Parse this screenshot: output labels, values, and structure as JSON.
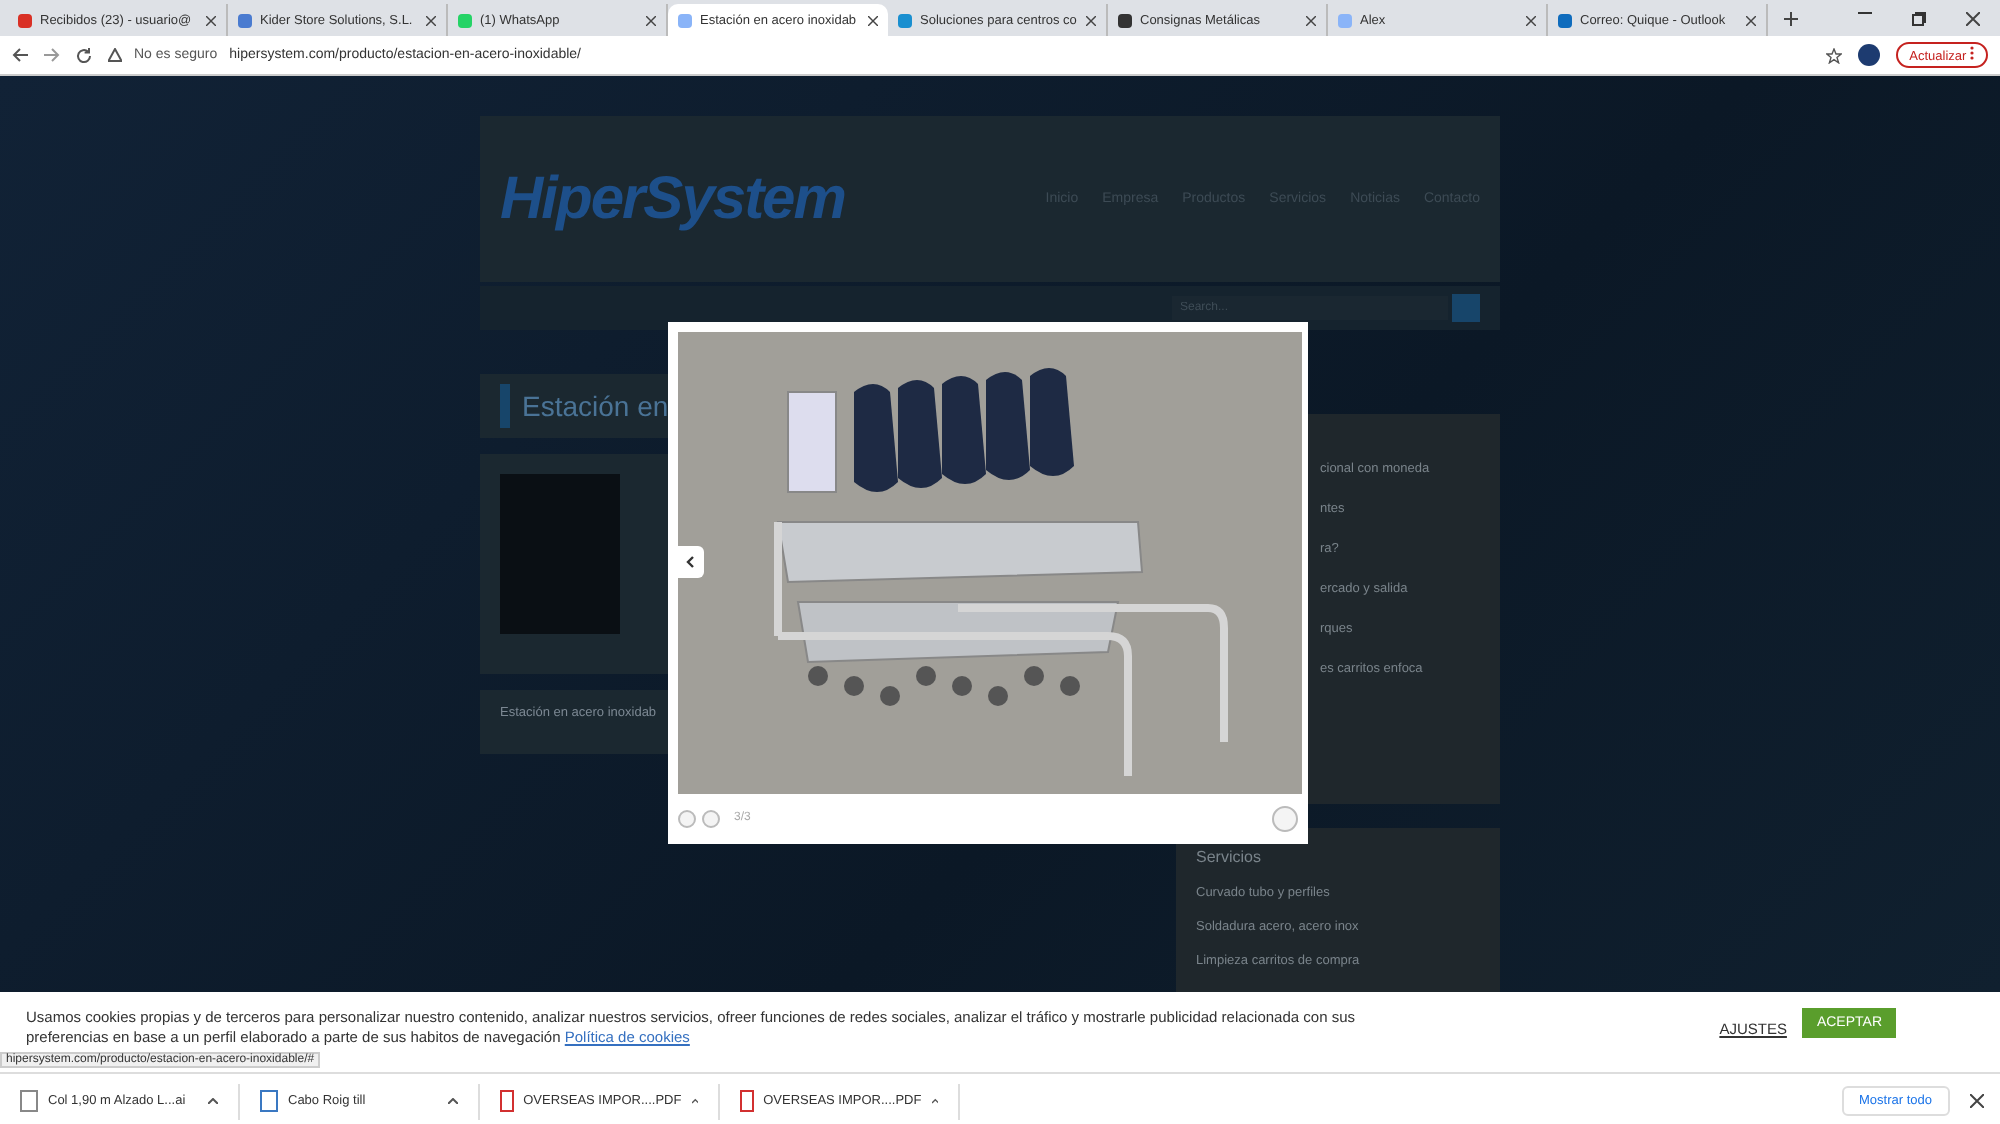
{
  "browser": {
    "tabs": [
      {
        "title": "Recibidos (23) - usuario@",
        "kind": "mail",
        "selected": false
      },
      {
        "title": "Kider Store Solutions, S.L.",
        "kind": "site",
        "selected": false
      },
      {
        "title": "(1) WhatsApp",
        "kind": "chat",
        "selected": false
      },
      {
        "title": "Estación en acero inoxidab",
        "kind": "page",
        "selected": true
      },
      {
        "title": "Soluciones para centros co",
        "kind": "globe",
        "selected": false
      },
      {
        "title": "Consignas Metálicas",
        "kind": "dark",
        "selected": false
      },
      {
        "title": "Alex",
        "kind": "page",
        "selected": false
      },
      {
        "title": "Correo: Quique - Outlook",
        "kind": "outlook",
        "selected": false
      }
    ],
    "security": "No es seguro",
    "url": "hipersystem.com/producto/estacion-en-acero-inoxidable/",
    "update_button": "Actualizar"
  },
  "site": {
    "logo": "HiperSystem",
    "nav": [
      "Inicio",
      "Empresa",
      "Productos",
      "Servicios",
      "Noticias",
      "Contacto"
    ],
    "search": {
      "placeholder": "Search..."
    },
    "page_title": "Estación en",
    "description": "Estación en acero inoxidab",
    "sidebar": [
      "cional con moneda",
      "ntes",
      "ra?",
      "ercado y salida",
      "rques",
      "es carritos enfoca"
    ],
    "services": {
      "title": "Servicios",
      "items": [
        "Curvado tubo y perfiles",
        "Soldadura acero, acero inox",
        "Limpieza carritos de compra"
      ]
    }
  },
  "lightbox": {
    "counter": "3/3"
  },
  "cookie_bar": {
    "text": "Usamos cookies propias y de terceros para personalizar nuestro contenido, analizar nuestros servicios, ofreer funciones de redes sociales, analizar el tráfico y mostrarle publicidad relacionada con sus preferencias en base a un perfil elaborado a parte de sus habitos de navegación",
    "link": "Política de cookies",
    "settings": "AJUSTES",
    "accept": "ACEPTAR"
  },
  "status_url": "hipersystem.com/producto/estacion-en-acero-inoxidable/#",
  "downloads": {
    "items": [
      {
        "name": "Col 1,90 m Alzado L...ai",
        "kind": "file"
      },
      {
        "name": "Cabo Roig till",
        "kind": "doc"
      },
      {
        "name": "OVERSEAS IMPOR....PDF",
        "kind": "pdf"
      },
      {
        "name": "OVERSEAS IMPOR....PDF",
        "kind": "pdf"
      }
    ],
    "show_all": "Mostrar todo"
  }
}
